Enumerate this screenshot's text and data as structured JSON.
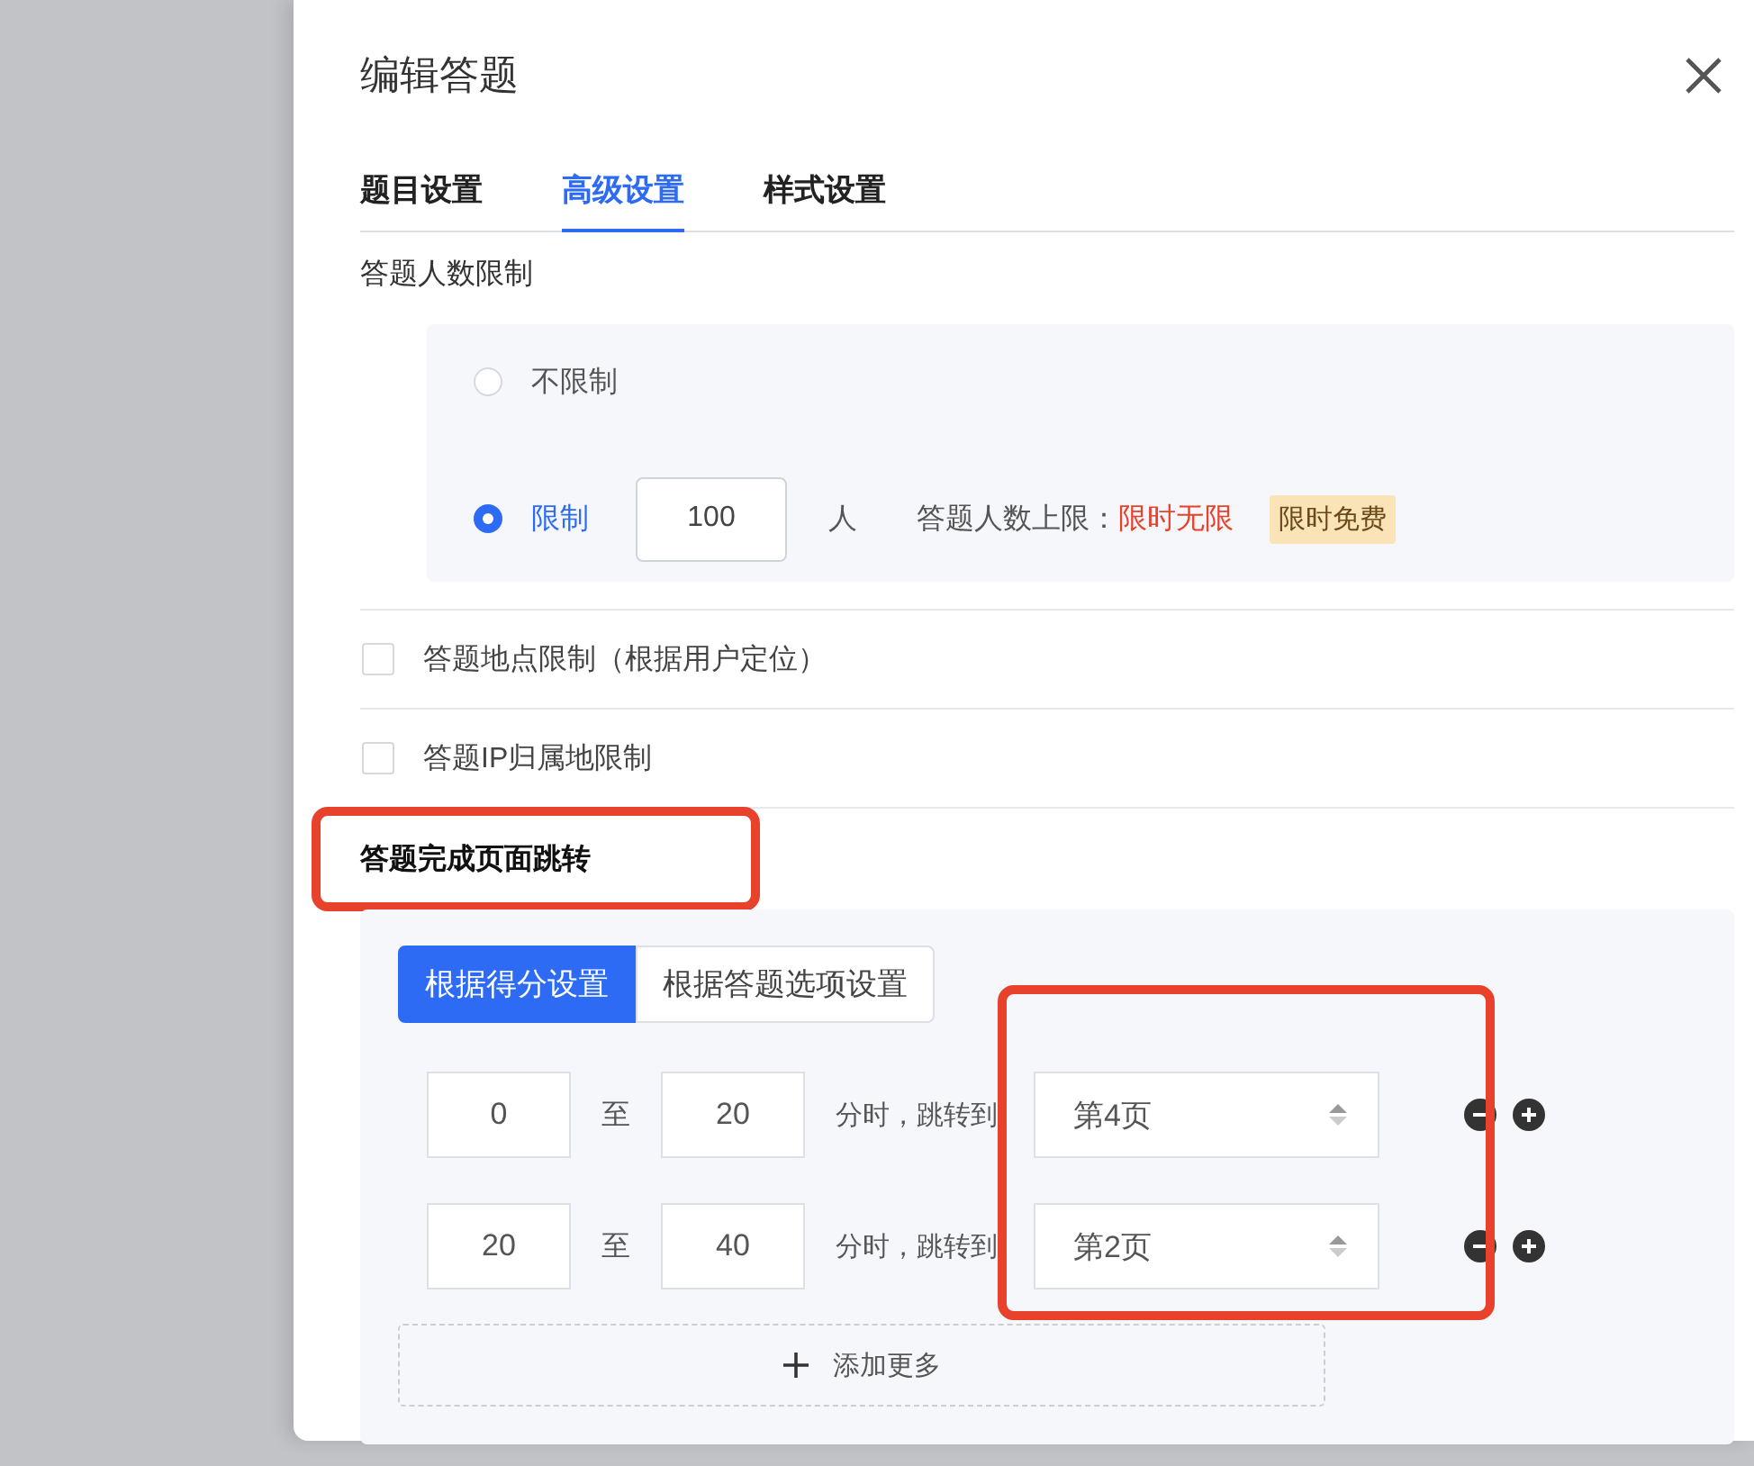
{
  "dialog": {
    "title": "编辑答题"
  },
  "tabs": [
    {
      "label": "题目设置",
      "selected": false
    },
    {
      "label": "高级设置",
      "selected": true
    },
    {
      "label": "样式设置",
      "selected": false
    }
  ],
  "respondent_limit": {
    "label": "答题人数限制",
    "options": [
      {
        "label": "不限制",
        "selected": false
      },
      {
        "label": "限制",
        "selected": true,
        "value": "100",
        "unit": "人",
        "cap_label": "答题人数上限：",
        "cap_value": "限时无限",
        "badge": "限时免费"
      }
    ]
  },
  "checkboxes": [
    {
      "label": "答题地点限制（根据用户定位）",
      "checked": false
    },
    {
      "label": "答题IP归属地限制",
      "checked": false
    }
  ],
  "completion_redirect": {
    "title": "答题完成页面跳转",
    "highlighted": true,
    "modes": [
      {
        "label": "根据得分设置",
        "selected": true
      },
      {
        "label": "根据答题选项设置",
        "selected": false
      }
    ],
    "targets_highlighted": true,
    "rules": [
      {
        "from": "0",
        "separator": "至",
        "to": "20",
        "text": "分时，跳转到",
        "target": "第4页"
      },
      {
        "from": "20",
        "separator": "至",
        "to": "40",
        "text": "分时，跳转到",
        "target": "第2页"
      }
    ],
    "add_more": {
      "label": "添加更多"
    }
  }
}
